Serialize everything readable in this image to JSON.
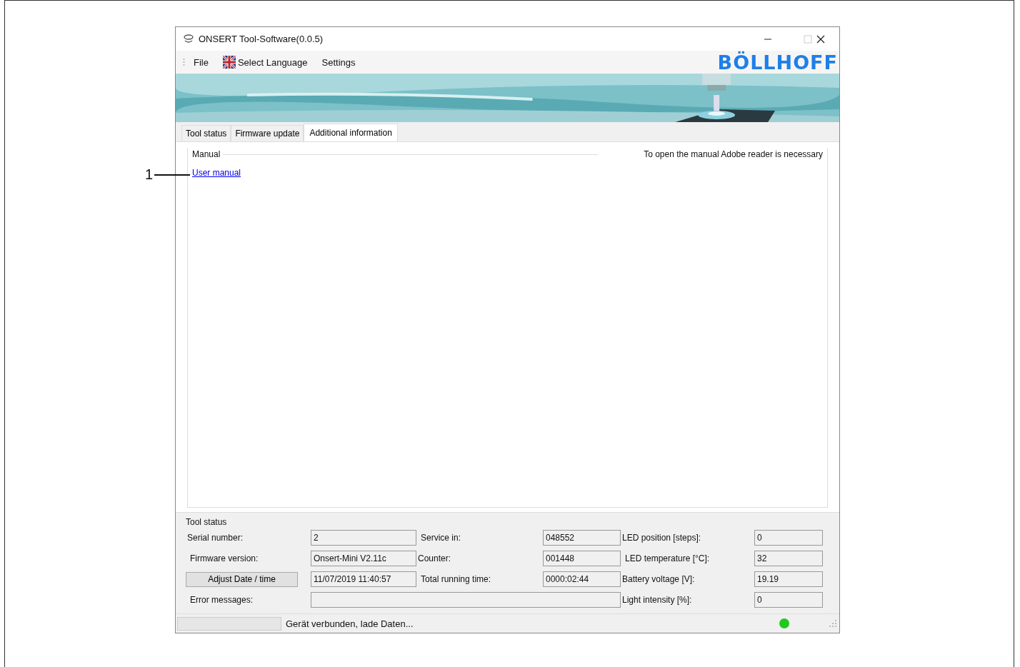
{
  "callout": "1",
  "window": {
    "title": "ONSERT Tool-Software(0.0.5)"
  },
  "menu": [
    {
      "label": "File",
      "kind": "plain"
    },
    {
      "label": "Select Language",
      "kind": "flag"
    },
    {
      "label": "Settings",
      "kind": "plain"
    }
  ],
  "logo": "BÖLLHOFF",
  "tabs": [
    {
      "label": "Tool status",
      "selected": false
    },
    {
      "label": "Firmware update",
      "selected": false
    },
    {
      "label": "Additional information",
      "selected": true
    }
  ],
  "manual": {
    "title": "Manual",
    "note": "To open the manual Adobe reader is necessary",
    "link": "User manual"
  },
  "tool_status": {
    "title": "Tool status",
    "items": [
      {
        "kind": "field",
        "label": "Serial number:",
        "value": "2"
      },
      {
        "kind": "field",
        "label": "Service in:",
        "value": "048552"
      },
      {
        "kind": "field",
        "label": "LED position [steps]:",
        "value": "0"
      },
      {
        "kind": "field",
        "label": "Firmware version:",
        "value": "Onsert-Mini V2.11c"
      },
      {
        "kind": "field",
        "label": "Counter:",
        "value": "001448"
      },
      {
        "kind": "field",
        "label": "LED temperature [°C]:",
        "value": "32"
      },
      {
        "kind": "button",
        "label": "Adjust Date / time",
        "value": "11/07/2019 11:40:57"
      },
      {
        "kind": "field",
        "label": "Total running time:",
        "value": "0000:02:44"
      },
      {
        "kind": "field",
        "label": "Battery voltage [V]:",
        "value": "19.19"
      },
      {
        "kind": "wide",
        "label": "Error messages:"
      },
      {
        "kind": "field",
        "label": "Light intensity [%]:",
        "value": "0"
      }
    ]
  },
  "status_bar": {
    "level": 0,
    "text": "Gerät verbunden, lade Daten...",
    "connected": true
  }
}
